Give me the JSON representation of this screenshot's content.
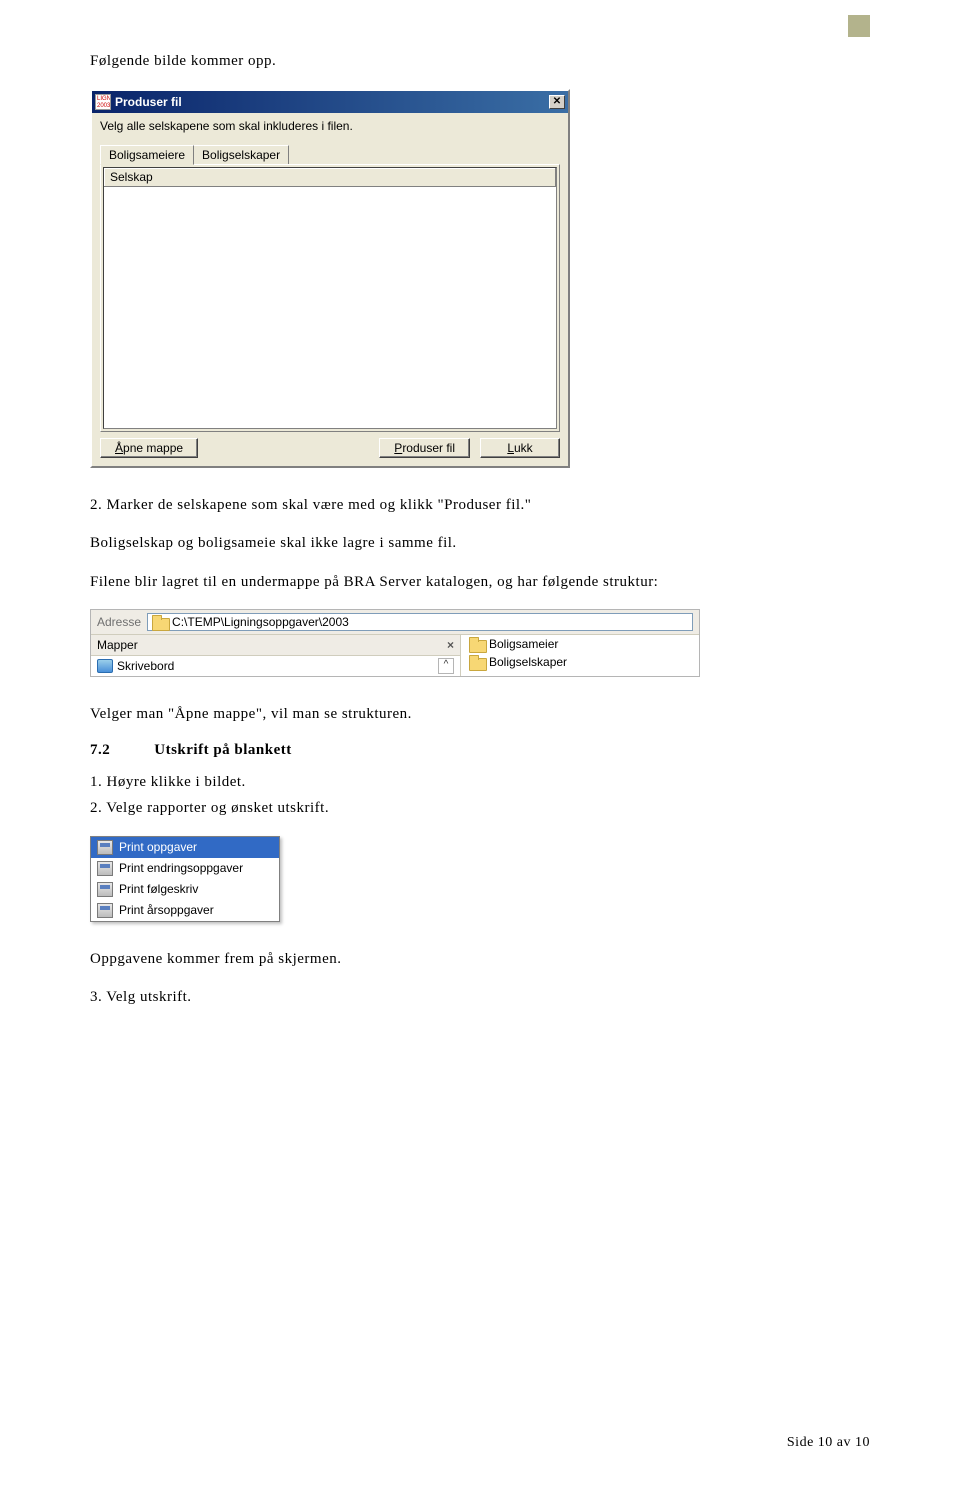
{
  "intro_text": "Følgende bilde kommer opp.",
  "dialog": {
    "title": "Produser fil",
    "icon_label": "LIGN 2003",
    "instruction": "Velg alle selskapene som skal inkluderes i filen.",
    "tabs": [
      "Boligsameiere",
      "Boligselskaper"
    ],
    "column_header": "Selskap",
    "buttons": {
      "open": "Åpne mappe",
      "produce": "Produser fil",
      "close": "Lukk"
    }
  },
  "para2_line1": "2. Marker de selskapene som skal være med og klikk \"Produser fil.\"",
  "para2_line2": "Boligselskap og boligsameie skal ikke lagre i samme fil.",
  "para3": "Filene blir lagret til en undermappe på BRA Server katalogen, og har følgende struktur:",
  "explorer": {
    "address_label": "Adresse",
    "address_path": "C:\\TEMP\\Ligningsoppgaver\\2003",
    "left_header": "Mapper",
    "desktop": "Skrivebord",
    "right_items": [
      "Boligsameier",
      "Boligselskaper"
    ]
  },
  "para4": "Velger man \"Åpne mappe\", vil man se strukturen.",
  "section": {
    "num": "7.2",
    "title": "Utskrift på blankett",
    "item1": "1. Høyre klikke i bildet.",
    "item2": "2. Velge rapporter og ønsket utskrift."
  },
  "menu": {
    "items": [
      "Print oppgaver",
      "Print endringsoppgaver",
      "Print følgeskriv",
      "Print årsoppgaver"
    ]
  },
  "para5": "Oppgavene kommer frem på skjermen.",
  "para6": "3. Velg utskrift.",
  "footer": "Side 10 av 10"
}
